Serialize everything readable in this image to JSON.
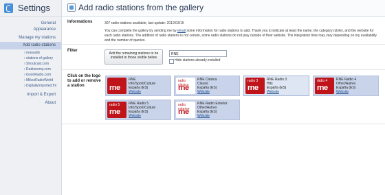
{
  "sidebar": {
    "title": "Settings",
    "items": [
      {
        "label": "General"
      },
      {
        "label": "Appearance"
      },
      {
        "label": "Manage my stations"
      },
      {
        "label": "Add radio stations"
      },
      {
        "label": "Import & Export"
      },
      {
        "label": "About"
      }
    ],
    "subitems": [
      {
        "label": "› manually"
      },
      {
        "label": "› stations of gallery"
      },
      {
        "label": "› Shoutcast.com"
      },
      {
        "label": "› Radionomy.com"
      },
      {
        "label": "› GoonRadio.com"
      },
      {
        "label": "› MikesRadioWorld"
      },
      {
        "label": "› DigitallyImported.fm"
      }
    ]
  },
  "header": {
    "title": "Add radio stations from the gallery"
  },
  "informations": {
    "label": "Informations",
    "count_line": "307 radio stations available, last update: 2012/03/15",
    "para_part1": "You can complete the gallery by sending me by",
    "para_link": "email",
    "para_part2": "some information for radio stations to add. Thank you to indicate at least the name, the category (style), and the website for each radio stations. The addition of radio stations is not certain, some radio stations do not play outside of their website. The integration time may vary depending on my availability and the number of queries."
  },
  "filter": {
    "label": "Filter",
    "button_label": "Add the remaining stations to be installed in those visible below",
    "input_value": "RNE",
    "checkbox_label": "Hide stations already installed"
  },
  "gallery": {
    "label_line1": "Click on the logo",
    "label_line2": "to add or remove",
    "label_line3": "a station",
    "stations": [
      {
        "name": "RNE",
        "genre": "Info/Sport/Culture",
        "country": "España (ES)",
        "link": "Website",
        "logo_top": "",
        "logo_text": "rne",
        "logo_bg": "#c0141b",
        "white": false
      },
      {
        "name": "RNE Clásica",
        "genre": "Classic",
        "country": "España (ES)",
        "link": "Website",
        "logo_top": "radio clásica",
        "logo_text": "rne",
        "logo_bg": "#ffffff",
        "white": true
      },
      {
        "name": "RNE Radio 3",
        "genre": "Hits",
        "country": "España (ES)",
        "link": "Website",
        "logo_top": "radio 3",
        "logo_text": "rne",
        "logo_bg": "#c0141b",
        "white": false
      },
      {
        "name": "RNE Radio 4",
        "genre": "Other/Autres",
        "country": "España (ES)",
        "link": "Website",
        "logo_top": "ràdio 4",
        "logo_text": "rne",
        "logo_bg": "#c0141b",
        "white": false
      },
      {
        "name": "RNE Radio 5",
        "genre": "Info/Sport/Culture",
        "country": "España (ES)",
        "link": "Website",
        "logo_top": "radio 5",
        "logo_text": "rne",
        "logo_bg": "#c0141b",
        "white": false
      },
      {
        "name": "RNE Radio Exterior",
        "genre": "Other/Autres",
        "country": "España (ES)",
        "link": "Website",
        "logo_top": "radio exterior",
        "logo_text": "rne",
        "logo_bg": "#ffffff",
        "white": true
      }
    ]
  }
}
